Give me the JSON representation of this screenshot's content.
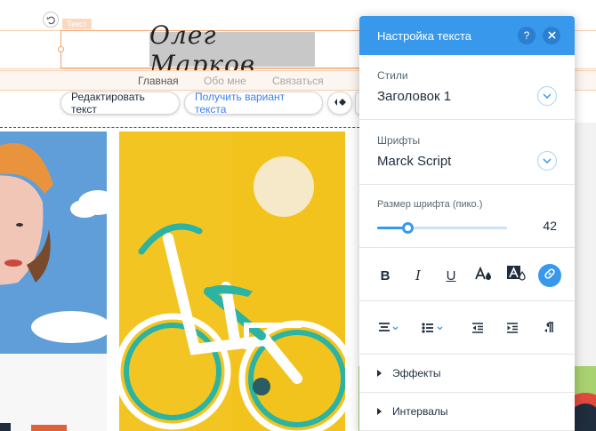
{
  "editor": {
    "element_tag": "Текст",
    "site_title": "Олег Марков",
    "menu": [
      "Главная",
      "Обо мне",
      "Связаться"
    ],
    "toolbar": {
      "edit_text": "Редактировать текст",
      "get_variant": "Получить вариант текста"
    }
  },
  "panel": {
    "title": "Настройка текста",
    "help_icon": "?",
    "styles_label": "Стили",
    "styles_value": "Заголовок 1",
    "fonts_label": "Шрифты",
    "fonts_value": "Marck Script",
    "font_size_label": "Размер шрифта (пико.)",
    "font_size_value": "42",
    "font_size_fraction": 0.23,
    "format_buttons": {
      "bold": "B",
      "italic": "I",
      "underline": "U"
    },
    "effects_label": "Эффекты",
    "spacing_label": "Интервалы"
  },
  "colors": {
    "accent": "#3899ec",
    "selection": "#f3a56e"
  }
}
